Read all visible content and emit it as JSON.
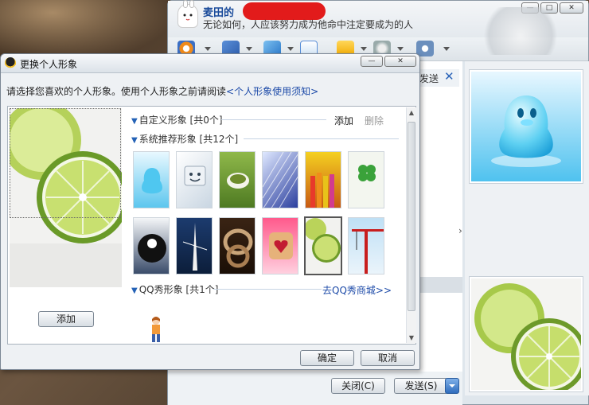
{
  "chat": {
    "name": "麦田的",
    "motto": "无论如何，人应该努力成为他命中注定要成为的人",
    "send_tab": "发送",
    "close_button": "关闭(C)",
    "send_button": "发送(S)",
    "window_controls": [
      "—",
      "□",
      "✕"
    ]
  },
  "dialog": {
    "title": "更换个人形象",
    "description": "请选择您喜欢的个人形象。使用个人形象之前请阅读",
    "description_link": "<个人形象使用须知>",
    "custom_section": "自定义形象 [共0个]",
    "add_link": "添加",
    "delete_link": "删除",
    "system_section": "系统推荐形象 [共12个]",
    "qqshow_section": "QQ秀形象 [共1个]",
    "qqshow_link": "去QQ秀商城>>",
    "left_add_button": "添加",
    "ok_button": "确定",
    "cancel_button": "取消",
    "window_controls": [
      "—",
      "✕"
    ]
  },
  "thumbnails": [
    {
      "name": "qq-penguin"
    },
    {
      "name": "keyboard-smile"
    },
    {
      "name": "coffee-cup"
    },
    {
      "name": "building"
    },
    {
      "name": "colored-pencils"
    },
    {
      "name": "clover"
    },
    {
      "name": "billiard-ball"
    },
    {
      "name": "rowing-boat"
    },
    {
      "name": "rope"
    },
    {
      "name": "heart-toast"
    },
    {
      "name": "lime"
    },
    {
      "name": "crane"
    }
  ],
  "colors": {
    "link": "#1c4aa8",
    "accent_blue": "#2462b6",
    "censor_red": "#e21b1b"
  }
}
